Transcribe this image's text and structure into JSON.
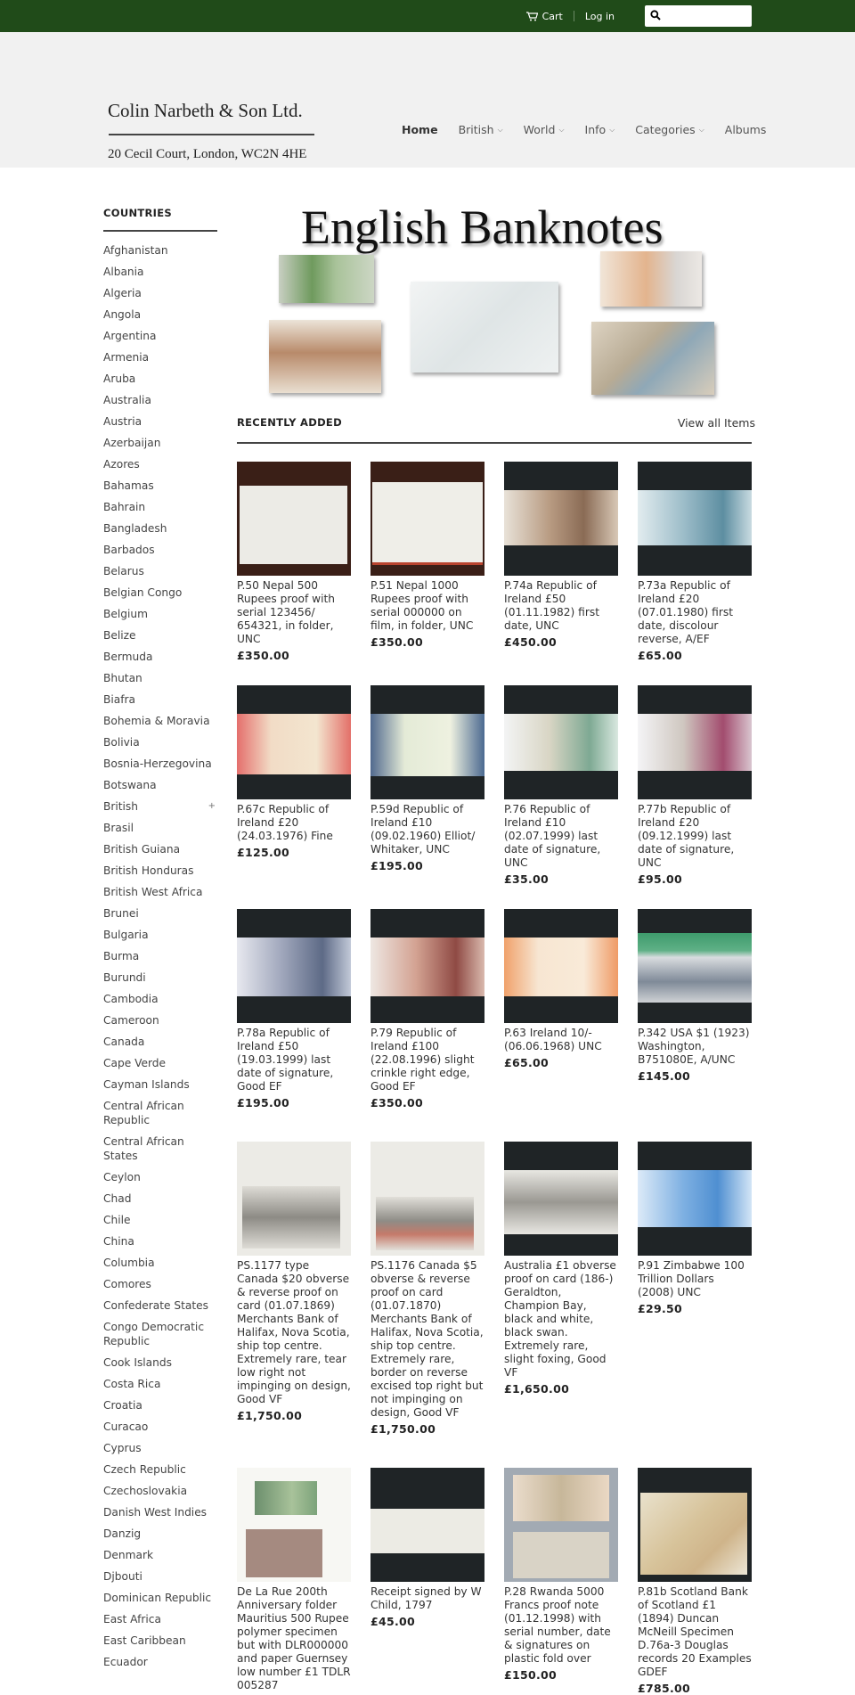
{
  "topbar": {
    "cart_label": "Cart",
    "login_label": "Log in",
    "search_placeholder": "",
    "search_value": "",
    "background": "#204b19"
  },
  "header": {
    "store_name": "Colin Narbeth & Son Ltd.",
    "address": "20 Cecil Court, London, WC2N 4HE",
    "nav": [
      {
        "label": "Home",
        "active": true,
        "dropdown": false
      },
      {
        "label": "British",
        "active": false,
        "dropdown": true
      },
      {
        "label": "World",
        "active": false,
        "dropdown": true
      },
      {
        "label": "Info",
        "active": false,
        "dropdown": true
      },
      {
        "label": "Categories",
        "active": false,
        "dropdown": true
      },
      {
        "label": "Albums",
        "active": false,
        "dropdown": false
      }
    ]
  },
  "sidebar": {
    "heading": "COUNTRIES",
    "countries": [
      "Afghanistan",
      "Albania",
      "Algeria",
      "Angola",
      "Argentina",
      "Armenia",
      "Aruba",
      "Australia",
      "Austria",
      "Azerbaijan",
      "Azores",
      "Bahamas",
      "Bahrain",
      "Bangladesh",
      "Barbados",
      "Belarus",
      "Belgian Congo",
      "Belgium",
      "Belize",
      "Bermuda",
      "Bhutan",
      "Biafra",
      "Bohemia & Moravia",
      "Bolivia",
      "Bosnia-Herzegovina",
      "Botswana",
      "British",
      "Brasil",
      "British Guiana",
      "British Honduras",
      "British West Africa",
      "Brunei",
      "Bulgaria",
      "Burma",
      "Burundi",
      "Cambodia",
      "Cameroon",
      "Canada",
      "Cape Verde",
      "Cayman Islands",
      "Central African Republic",
      "Central African States",
      "Ceylon",
      "Chad",
      "Chile",
      "China",
      "Columbia",
      "Comores",
      "Confederate States",
      "Congo Democratic Republic",
      "Cook Islands",
      "Costa Rica",
      "Croatia",
      "Curacao",
      "Cyprus",
      "Czech Republic",
      "Czechoslovakia",
      "Danish West Indies",
      "Danzig",
      "Denmark",
      "Djbouti",
      "Dominican Republic",
      "East Africa",
      "East Caribbean",
      "Ecuador"
    ],
    "expandable": "British",
    "expand_icon": "+"
  },
  "banner": {
    "title": "English Banknotes"
  },
  "recent": {
    "heading": "RECENTLY ADDED",
    "view_all": "View all Items",
    "products": [
      {
        "title": "P.50 Nepal 500 Rupees proof with serial 123456/ 654321, in folder, UNC",
        "price": "£350.00",
        "img": "folder-brown"
      },
      {
        "title": "P.51 Nepal 1000 Rupees proof with serial 000000 on film, in folder, UNC",
        "price": "£350.00",
        "img": "folder-red"
      },
      {
        "title": "P.74a Republic of Ireland £50 (01.11.1982) first date, UNC",
        "price": "£450.00",
        "img": "note-brown"
      },
      {
        "title": "P.73a Republic of Ireland £20 (07.01.1980) first date, discolour reverse, A/EF",
        "price": "£65.00",
        "img": "note-blue"
      },
      {
        "title": "P.67c Republic of Ireland £20 (24.03.1976) Fine",
        "price": "£125.00",
        "img": "note-red"
      },
      {
        "title": "P.59d Republic of Ireland £10 (09.02.1960) Elliot/ Whitaker, UNC",
        "price": "£195.00",
        "img": "note-navy"
      },
      {
        "title": "P.76 Republic of Ireland £10 (02.07.1999) last date of signature, UNC",
        "price": "£35.00",
        "img": "note-green"
      },
      {
        "title": "P.77b Republic of Ireland £20 (09.12.1999) last date of signature, UNC",
        "price": "£95.00",
        "img": "note-purple"
      },
      {
        "title": "P.78a Republic of Ireland £50 (19.03.1999) last date of signature, Good EF",
        "price": "£195.00",
        "img": "note-slate"
      },
      {
        "title": "P.79 Republic of Ireland £100 (22.08.1996) slight crinkle right edge, Good EF",
        "price": "£350.00",
        "img": "note-maroon"
      },
      {
        "title": "P.63 Ireland 10/- (06.06.1968) UNC",
        "price": "£65.00",
        "img": "note-orange"
      },
      {
        "title": "P.342 USA $1 (1923) Washington, B751080E, A/UNC",
        "price": "£145.00",
        "img": "note-pcgs"
      },
      {
        "title": "PS.1177 type Canada $20 obverse & reverse proof on card (01.07.1869) Merchants Bank of Halifax, Nova Scotia, ship top centre. Extremely rare, tear low right not impinging on design, Good VF",
        "price": "£1,750.00",
        "img": "proof-grey"
      },
      {
        "title": "PS.1176 Canada $5 obverse & reverse proof on card (01.07.1870) Merchants Bank of Halifax, Nova Scotia, ship top centre. Extremely rare, border on reverse excised top right but not impinging on design, Good VF",
        "price": "£1,750.00",
        "img": "proof-grey-red"
      },
      {
        "title": "Australia £1 obverse proof on card (186-) Geraldton, Champion Bay, black and white, black swan. Extremely rare, slight foxing, Good VF",
        "price": "£1,650.00",
        "img": "proof-bw"
      },
      {
        "title": "P.91 Zimbabwe 100 Trillion Dollars (2008) UNC",
        "price": "£29.50",
        "img": "note-lightblue"
      },
      {
        "title": "De La Rue 200th Anniversary folder Mauritius 500 Rupee polymer specimen but with DLR000000 and paper Guernsey low number £1 TDLR 005287",
        "price": "",
        "img": "folder-white"
      },
      {
        "title": "Receipt signed by W Child, 1797",
        "price": "£45.00",
        "img": "receipt"
      },
      {
        "title": "P.28 Rwanda 5000 Francs proof note (01.12.1998) with serial number, date & signatures on plastic fold over",
        "price": "£150.00",
        "img": "rwanda"
      },
      {
        "title": "P.81b Scotland Bank of Scotland £1 (1894) Duncan McNeill Specimen D.76a-3 Douglas records 20 Examples GDEF",
        "price": "£785.00",
        "img": "scotland"
      }
    ]
  }
}
